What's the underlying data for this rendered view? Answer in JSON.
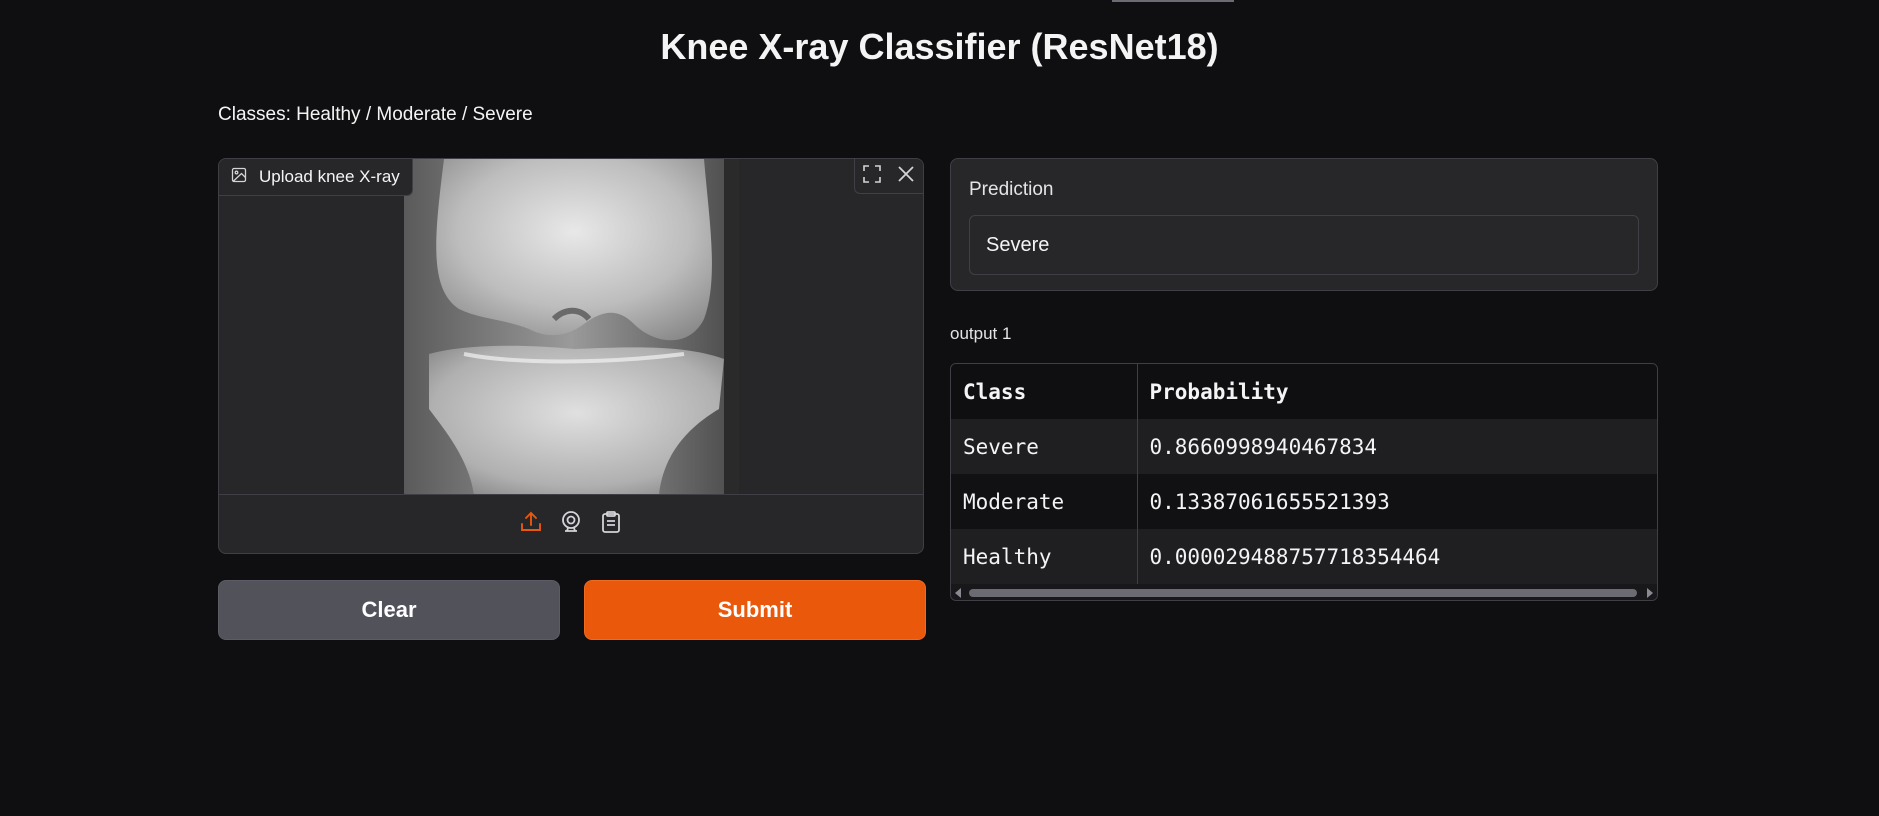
{
  "title": "Knee X-ray Classifier (ResNet18)",
  "subtitle": "Classes: Healthy / Moderate / Severe",
  "image_input": {
    "label": "Upload knee X-ray",
    "label_icon": "image-icon",
    "actions": [
      "fullscreen-icon",
      "close-icon"
    ],
    "sources": [
      "upload-icon",
      "webcam-icon",
      "clipboard-icon"
    ]
  },
  "buttons": {
    "clear": "Clear",
    "submit": "Submit"
  },
  "prediction": {
    "label": "Prediction",
    "value": "Severe"
  },
  "output": {
    "label": "output 1",
    "headers": [
      "Class",
      "Probability"
    ],
    "rows": [
      [
        "Severe",
        "0.8660998940467834"
      ],
      [
        "Moderate",
        "0.13387061655521393"
      ],
      [
        "Healthy",
        "0.000029488757718354464"
      ]
    ]
  },
  "colors": {
    "background": "#0f0f11",
    "panel": "#27272a",
    "accent": "#ea580c",
    "clear_button": "#52525b"
  }
}
